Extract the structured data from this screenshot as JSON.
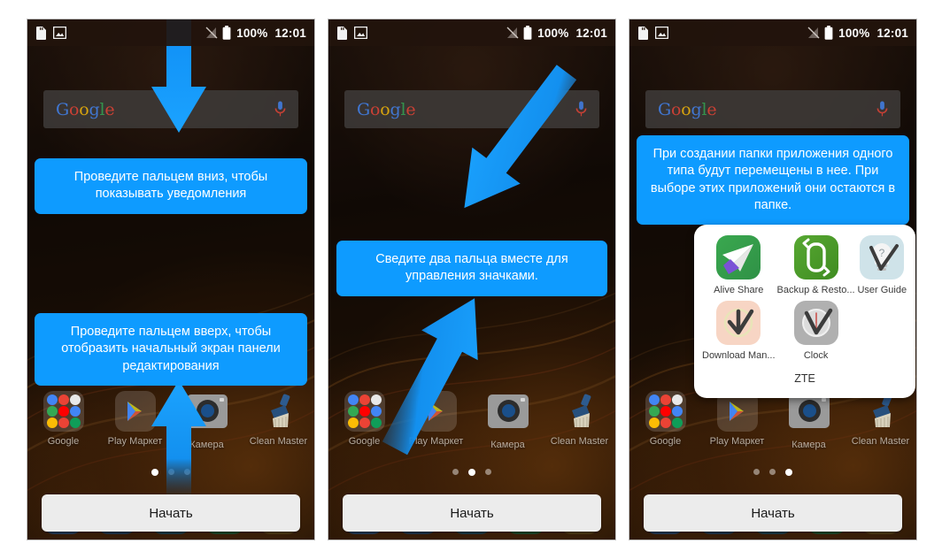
{
  "status_bar": {
    "icons_left": [
      "sd-card-icon",
      "image-icon"
    ],
    "signal_icon": "no-signal-icon",
    "battery_icon": "battery-full-icon",
    "battery_percent": "100%",
    "clock": "12:01"
  },
  "search": {
    "logo_letters": [
      "G",
      "o",
      "o",
      "g",
      "l",
      "e"
    ],
    "mic_icon": "microphone-icon"
  },
  "colors": {
    "tooltip_blue": "#0e9bff",
    "arrow_blue": "#1196ff",
    "start_button_bg": "#ececec"
  },
  "dock_apps": [
    {
      "label": "Google",
      "icon": "google-folder-icon"
    },
    {
      "label": "Play Маркет",
      "icon": "play-store-icon"
    },
    {
      "label": "Камера",
      "icon": "camera-icon"
    },
    {
      "label": "Clean Master",
      "icon": "clean-master-icon"
    }
  ],
  "start_button": {
    "label": "Начать"
  },
  "screens": [
    {
      "id": "screen-1",
      "page_dots": {
        "count": 3,
        "active_index": 0
      },
      "tooltips": [
        {
          "id": "tip-notifications",
          "text": "Проведите пальцем вниз, чтобы показывать уведомления"
        },
        {
          "id": "tip-edit-panel",
          "text": "Проведите пальцем вверх, чтобы отобразить начальный экран панели редактирования"
        }
      ],
      "arrows": [
        {
          "id": "arrow-down",
          "direction": "down"
        },
        {
          "id": "arrow-up",
          "direction": "up"
        }
      ]
    },
    {
      "id": "screen-2",
      "page_dots": {
        "count": 3,
        "active_index": 1
      },
      "tooltips": [
        {
          "id": "tip-pinch-icons",
          "text": "Сведите два пальца вместе для управления значками."
        }
      ],
      "arrows": [
        {
          "id": "arrow-diag-down-left",
          "direction": "down-left"
        },
        {
          "id": "arrow-diag-up-right",
          "direction": "up-right"
        }
      ]
    },
    {
      "id": "screen-3",
      "page_dots": {
        "count": 3,
        "active_index": 2
      },
      "tooltips": [
        {
          "id": "tip-folder",
          "text": "При создании папки приложения одного типа будут перемещены в нее. При выборе этих приложений они остаются в папке."
        }
      ],
      "arrows": [],
      "folder_popup": {
        "name": "ZTE",
        "apps": [
          {
            "label": "Alive Share",
            "icon": "alive-share-icon"
          },
          {
            "label": "Backup & Resto...",
            "icon": "backup-restore-icon"
          },
          {
            "label": "User Guide",
            "icon": "user-guide-icon"
          },
          {
            "label": "Download Man...",
            "icon": "download-manager-icon"
          },
          {
            "label": "Clock",
            "icon": "clock-icon"
          }
        ]
      }
    }
  ]
}
